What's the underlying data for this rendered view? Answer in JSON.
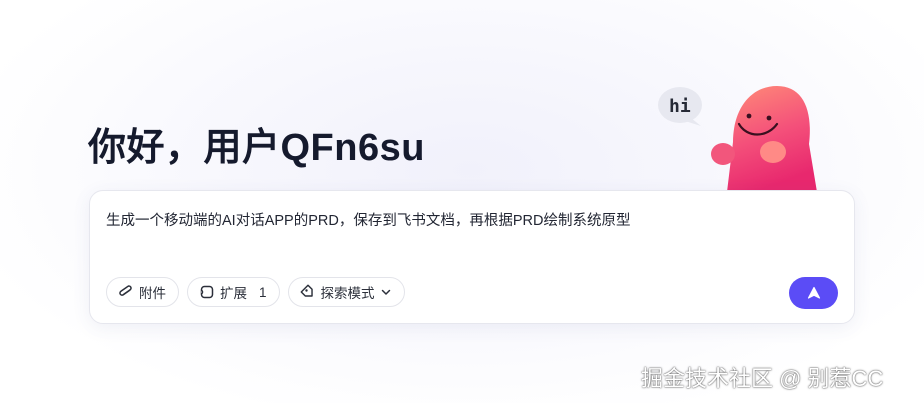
{
  "greeting": "你好，用户QFn6su",
  "mascot": {
    "bubble_text": "hi",
    "body_color": "#f04a7a"
  },
  "prompt": {
    "value": "生成一个移动端的AI对话APP的PRD，保存到飞书文档，再根据PRD绘制系统原型"
  },
  "toolbar": {
    "attach_label": "附件",
    "attach_icon": "paperclip-icon",
    "extend_label": "扩展",
    "extend_icon": "extension-icon",
    "extend_count": "1",
    "mode_label": "探索模式",
    "mode_icon": "explore-tag-icon",
    "mode_dropdown_icon": "chevron-down-icon"
  },
  "send": {
    "icon": "send-arrow-icon",
    "color": "#5b4cf6"
  },
  "watermark": "掘金技术社区 @ 别惹CC"
}
